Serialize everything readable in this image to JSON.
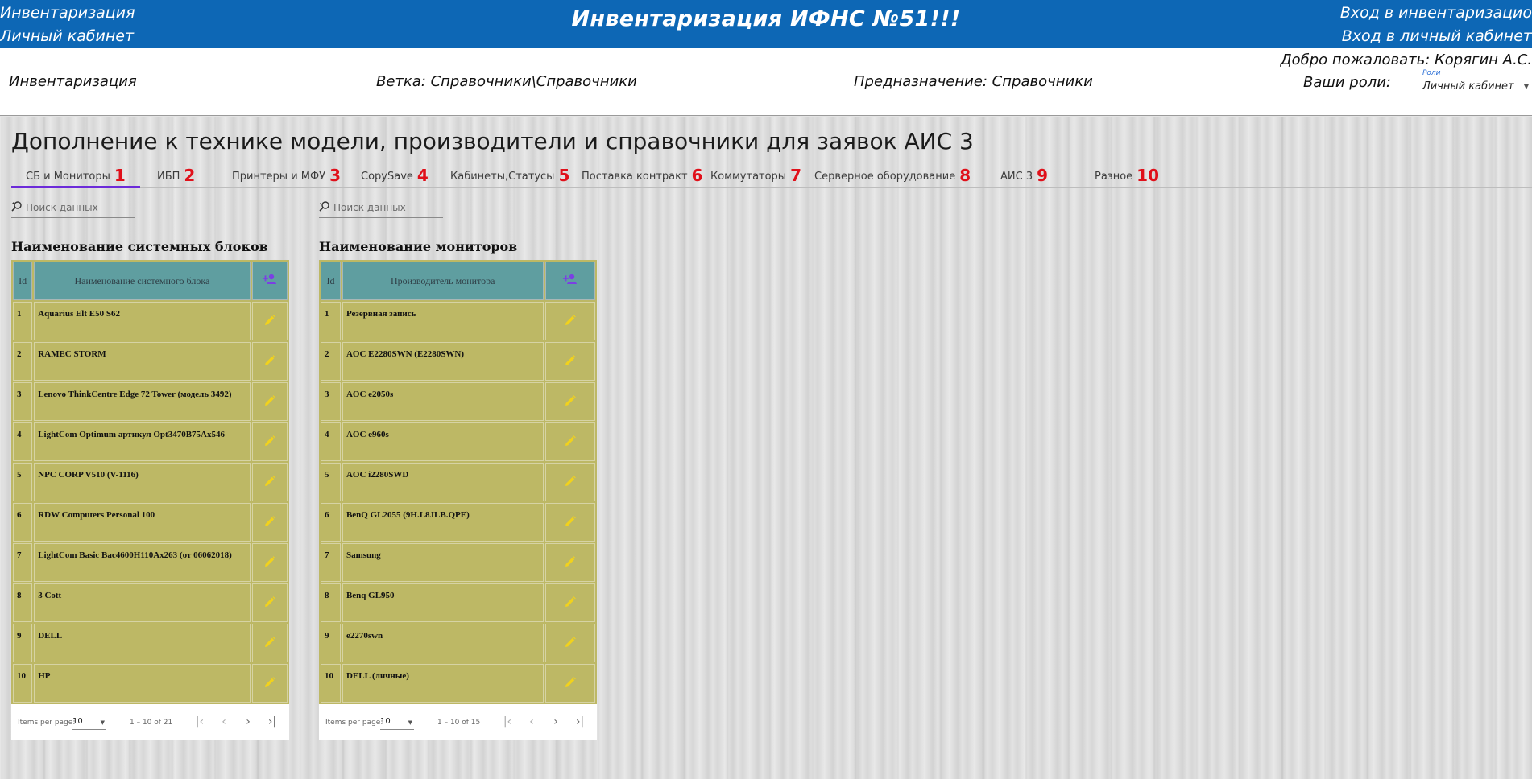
{
  "header": {
    "left_line1": "Инвентаризация",
    "left_line2": "Личный кабинет",
    "title": "Инвентаризация ИФНС №51!!!",
    "right_line1": "Вход в инвентаризацио",
    "right_line2": "Вход в личный кабинет"
  },
  "info": {
    "section": "Инвентаризация",
    "branch": "Ветка: Справочники\\Справочники",
    "purpose": "Предназначение: Справочники",
    "welcome": "Добро пожаловать: Корягин А.С.",
    "roles_label": "Ваши роли:",
    "roles_float_label": "Роли",
    "roles_value": "Личный кабинет"
  },
  "page_heading": "Дополнение к технике модели, производители и справочники для заявок АИС 3",
  "tabs": [
    {
      "label": "СБ и Мониторы",
      "num": "1"
    },
    {
      "label": "ИБП",
      "num": "2"
    },
    {
      "label": "Принтеры и МФУ",
      "num": "3"
    },
    {
      "label": "CopySave",
      "num": "4"
    },
    {
      "label": "Кабинеты,Статусы",
      "num": "5"
    },
    {
      "label": "Поставка контракт",
      "num": "6"
    },
    {
      "label": "Коммутаторы",
      "num": "7"
    },
    {
      "label": "Серверное оборудование",
      "num": "8"
    },
    {
      "label": "АИС 3",
      "num": "9"
    },
    {
      "label": "Разное",
      "num": "10"
    }
  ],
  "search_placeholder": "Поиск данных",
  "systems": {
    "title": "Наименование системных блоков",
    "col_id": "Id",
    "col_name": "Наименование системного блока",
    "rows": [
      {
        "id": "1",
        "name": "Aquarius Elt E50 S62"
      },
      {
        "id": "2",
        "name": "RAMEC STORM"
      },
      {
        "id": "3",
        "name": "Lenovo ThinkCentre Edge 72 Tower (модель 3492)"
      },
      {
        "id": "4",
        "name": "LightCom Optimum артикул Opt3470B75Ax546"
      },
      {
        "id": "5",
        "name": "NPC CORP V510 (V-1116)"
      },
      {
        "id": "6",
        "name": "RDW Computers Personal 100"
      },
      {
        "id": "7",
        "name": "LightCom Basic Bac4600H110Ax263 (от 06062018)"
      },
      {
        "id": "8",
        "name": "3 Cott"
      },
      {
        "id": "9",
        "name": "DELL"
      },
      {
        "id": "10",
        "name": "HP"
      }
    ],
    "pager": {
      "items_label": "Items per page:",
      "per_page": "10",
      "range": "1 – 10 of 21"
    }
  },
  "monitors": {
    "title": "Наименование мониторов",
    "col_id": "Id",
    "col_name": "Производитель монитора",
    "rows": [
      {
        "id": "1",
        "name": "Резервная запись"
      },
      {
        "id": "2",
        "name": "AOC E2280SWN (E2280SWN)"
      },
      {
        "id": "3",
        "name": "AOC e2050s"
      },
      {
        "id": "4",
        "name": "AOC e960s"
      },
      {
        "id": "5",
        "name": "AOC i2280SWD"
      },
      {
        "id": "6",
        "name": "BenQ GL2055 (9H.L8JLB.QPE)"
      },
      {
        "id": "7",
        "name": "Samsung"
      },
      {
        "id": "8",
        "name": "Benq GL950"
      },
      {
        "id": "9",
        "name": "e2270swn"
      },
      {
        "id": "10",
        "name": "DELL (личные)"
      }
    ],
    "pager": {
      "items_label": "Items per page:",
      "per_page": "10",
      "range": "1 – 10 of 15"
    }
  },
  "colors": {
    "header_blue": "#0d67b5",
    "table_header": "#5f9ea0",
    "table_row": "#bdb865",
    "tab_number_red": "#e0101a",
    "active_tab_underline": "#6c2bd9",
    "pencil_yellow": "#f2d21b",
    "add_purple": "#7b3fe4"
  },
  "icons": {
    "search": "search-icon",
    "edit": "pencil-icon",
    "add": "person-add-icon",
    "first": "first-page-icon",
    "prev": "chevron-left-icon",
    "next": "chevron-right-icon",
    "last": "last-page-icon"
  }
}
